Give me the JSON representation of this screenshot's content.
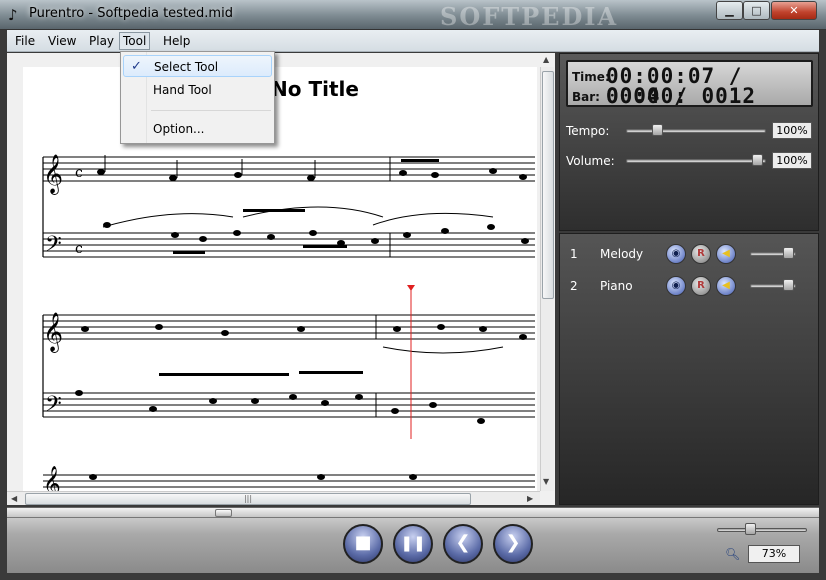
{
  "window": {
    "title": "Purentro - Softpedia tested.mid",
    "brand_watermark": "SOFTPEDIA",
    "controls": {
      "minimize": "▁",
      "maximize": "□",
      "close": "✕"
    }
  },
  "menubar": {
    "items": [
      {
        "id": "file",
        "label": "File"
      },
      {
        "id": "view",
        "label": "View"
      },
      {
        "id": "play",
        "label": "Play"
      },
      {
        "id": "tool",
        "label": "Tool"
      },
      {
        "id": "help",
        "label": "Help"
      }
    ]
  },
  "tool_menu": {
    "items": [
      {
        "label": "Select Tool",
        "checked": true
      },
      {
        "label": "Hand Tool",
        "checked": false
      },
      {
        "label": "Option...",
        "checked": false
      }
    ],
    "check_glyph": "✓"
  },
  "score": {
    "title": "No Title",
    "playhead_color": "#e02020"
  },
  "transport_display": {
    "time_label": "Time:",
    "time_value": "00:00:07 / 00:00:",
    "bar_label": "Bar:",
    "bar_value": "0004 / 0012"
  },
  "mixer": {
    "tempo_label": "Tempo:",
    "tempo_value": "100%",
    "tempo_level": 0.2,
    "volume_label": "Volume:",
    "volume_value": "100%",
    "volume_level": 0.98
  },
  "tracks": [
    {
      "number": "1",
      "name": "Melody",
      "level": 0.95
    },
    {
      "number": "2",
      "name": "Piano",
      "level": 0.95
    }
  ],
  "playback": {
    "stop_glyph": "■",
    "pause_glyph": "❚❚",
    "prev_glyph": "❮",
    "next_glyph": "❯",
    "zoom_value": "73%",
    "zoom_level": 0.35,
    "position_level": 0.26
  },
  "colors": {
    "accent": "#5c6ca8",
    "close": "#c0422c",
    "panel": "#3a3a3a"
  }
}
